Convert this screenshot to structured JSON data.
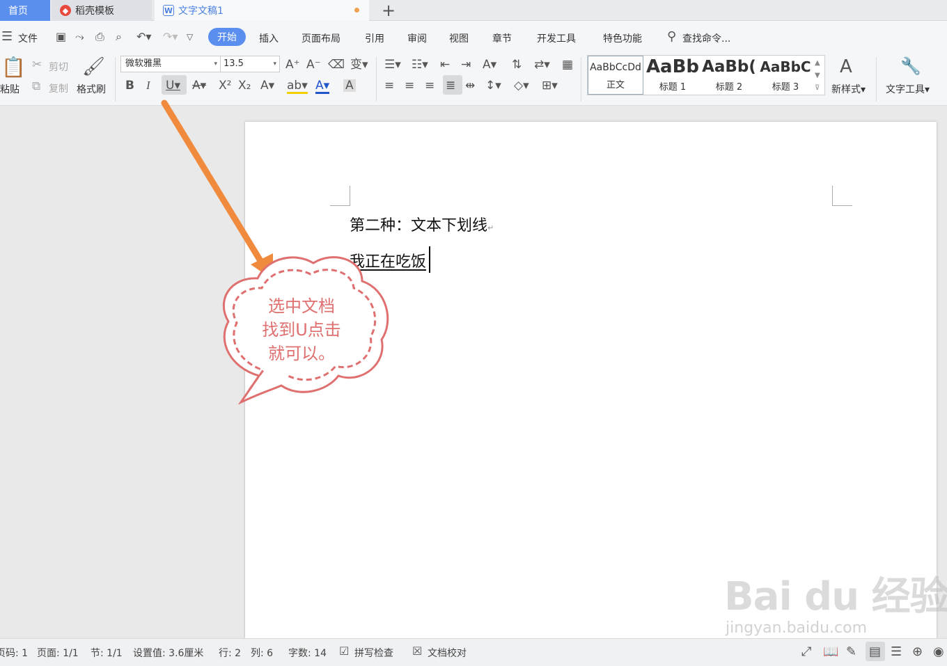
{
  "tabs": {
    "home": "首页",
    "docer": "稻壳模板",
    "doc": "文字文稿1",
    "new_tab": "+"
  },
  "menu": {
    "file": "文件",
    "items": [
      "开始",
      "插入",
      "页面布局",
      "引用",
      "审阅",
      "视图",
      "章节",
      "开发工具",
      "特色功能"
    ],
    "search": "查找命令..."
  },
  "ribbon": {
    "paste": "粘贴",
    "cut": "剪切",
    "copy": "复制",
    "format_painter": "格式刷",
    "font_name": "微软雅黑",
    "font_size": "13.5",
    "styles": [
      {
        "sample": "AaBbCcDd",
        "label": "正文"
      },
      {
        "sample": "AaBb",
        "label": "标题 1"
      },
      {
        "sample": "AaBb(",
        "label": "标题 2"
      },
      {
        "sample": "AaBbC",
        "label": "标题 3"
      }
    ],
    "new_style": "新样式",
    "text_tools": "文字工具"
  },
  "document": {
    "line1": "第二种：文本下划线",
    "line2": "我正在吃饭"
  },
  "annotation": {
    "line1": "选中文档",
    "line2": "找到U点击",
    "line3": "就可以。",
    "arrow_color": "#f08a3c",
    "bubble_color": "#e07070"
  },
  "watermark": {
    "brand": "Bai du 经验",
    "url": "jingyan.baidu.com"
  },
  "status": {
    "page_num": "页码: 1",
    "pages": "页面: 1/1",
    "section": "节: 1/1",
    "setting": "设置值: 3.6厘米",
    "row": "行: 2",
    "col": "列: 6",
    "words": "字数: 14",
    "spell": "拼写检查",
    "proof": "文档校对"
  },
  "colors": {
    "accent": "#5a8ff0",
    "tab_doc_text": "#4a80e0"
  }
}
